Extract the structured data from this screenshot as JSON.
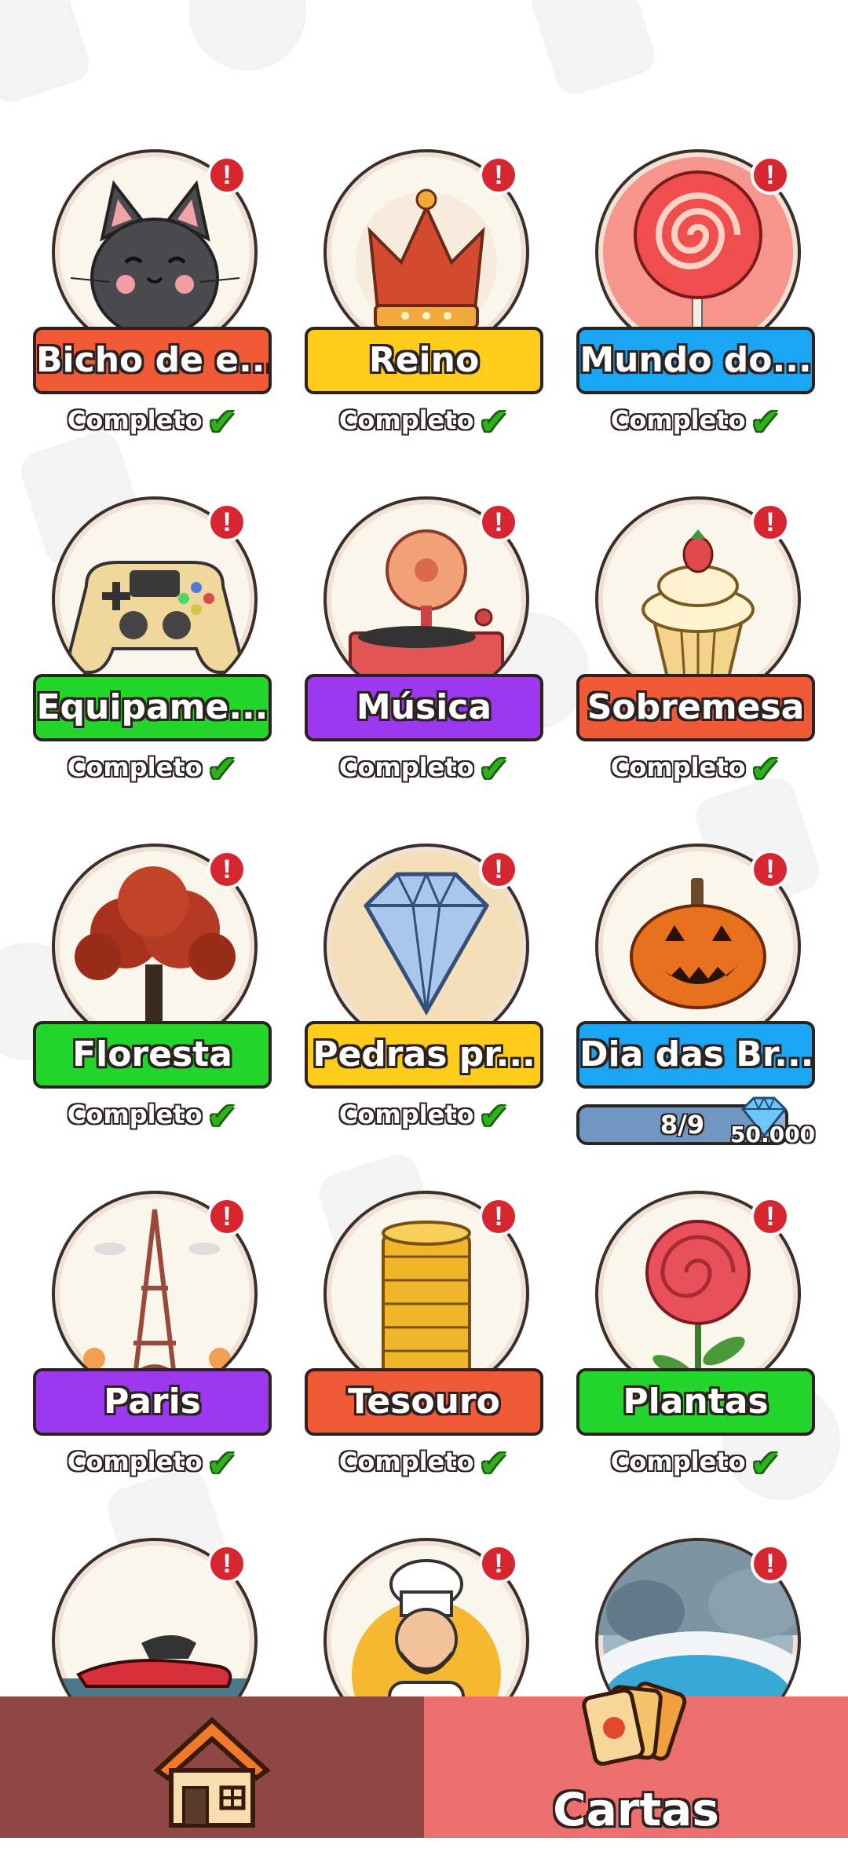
{
  "colors": {
    "red": "#f05a36",
    "yellow": "#ffcc1a",
    "blue": "#1aa6f4",
    "green": "#22d62b",
    "purple": "#9b38f0"
  },
  "collections": [
    {
      "label": "Bicho de e...",
      "color": "red",
      "status": "Completo",
      "icon": "cat-icon"
    },
    {
      "label": "Reino",
      "color": "yellow",
      "status": "Completo",
      "icon": "crown-icon"
    },
    {
      "label": "Mundo do...",
      "color": "blue",
      "status": "Completo",
      "icon": "lollipop-icon"
    },
    {
      "label": "Equipame...",
      "color": "green",
      "status": "Completo",
      "icon": "gamepad-icon"
    },
    {
      "label": "Música",
      "color": "purple",
      "status": "Completo",
      "icon": "turntable-icon"
    },
    {
      "label": "Sobremesa",
      "color": "red",
      "status": "Completo",
      "icon": "cupcake-icon"
    },
    {
      "label": "Floresta",
      "color": "green",
      "status": "Completo",
      "icon": "tree-icon"
    },
    {
      "label": "Pedras pr...",
      "color": "yellow",
      "status": "Completo",
      "icon": "diamond-icon"
    },
    {
      "label": "Dia das Br...",
      "color": "blue",
      "progress_text": "8/9",
      "progress": 0.889,
      "reward": "50.000",
      "icon": "pumpkin-icon"
    },
    {
      "label": "Paris",
      "color": "purple",
      "status": "Completo",
      "icon": "eiffel-tower-icon"
    },
    {
      "label": "Tesouro",
      "color": "red",
      "status": "Completo",
      "icon": "coin-stack-icon"
    },
    {
      "label": "Plantas",
      "color": "green",
      "status": "Completo",
      "icon": "rose-icon"
    },
    {
      "label": "",
      "icon": "jet-ski-icon"
    },
    {
      "label": "",
      "icon": "chef-icon"
    },
    {
      "label": "",
      "icon": "hot-spring-icon"
    }
  ],
  "alert_glyph": "!",
  "nav": {
    "home_icon": "house-icon",
    "cards_icon": "cards-icon",
    "cards_label": "Cartas"
  }
}
